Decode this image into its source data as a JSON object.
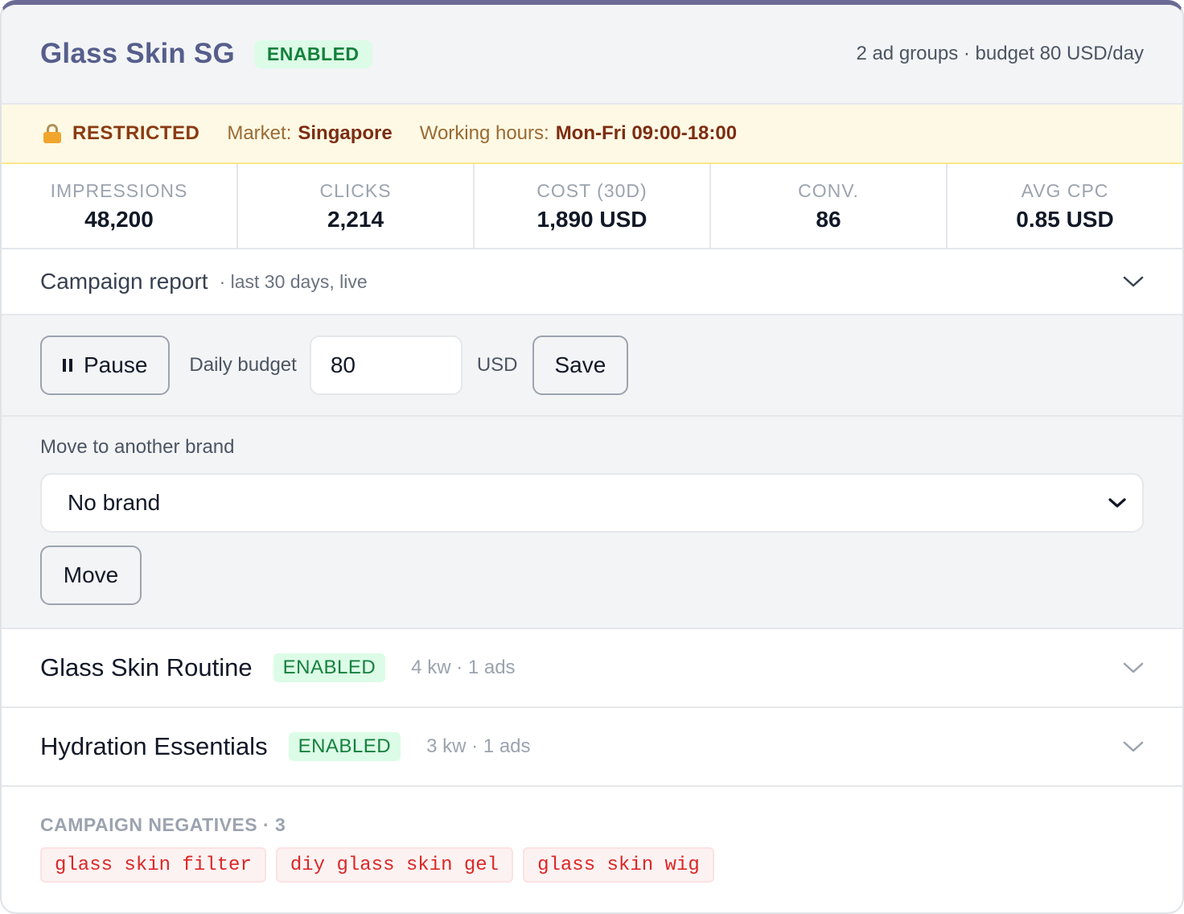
{
  "campaign": {
    "title": "Glass Skin SG",
    "status": "ENABLED",
    "meta": "2 ad groups · budget 80 USD/day"
  },
  "restriction": {
    "label": "RESTRICTED",
    "market_label": "Market:",
    "market_value": "Singapore",
    "hours_label": "Working hours:",
    "hours_value": "Mon-Fri 09:00-18:00"
  },
  "stats": [
    {
      "label": "IMPRESSIONS",
      "value": "48,200"
    },
    {
      "label": "CLICKS",
      "value": "2,214"
    },
    {
      "label": "COST (30D)",
      "value": "1,890 USD"
    },
    {
      "label": "CONV.",
      "value": "86"
    },
    {
      "label": "AVG CPC",
      "value": "0.85 USD"
    }
  ],
  "report": {
    "title": "Campaign report",
    "subtitle": "· last 30 days, live"
  },
  "controls": {
    "pause_label": "Pause",
    "budget_label": "Daily budget",
    "budget_value": "80",
    "currency": "USD",
    "save_label": "Save"
  },
  "move": {
    "label": "Move to another brand",
    "selected": "No brand",
    "button_label": "Move"
  },
  "ad_groups": [
    {
      "name": "Glass Skin Routine",
      "status": "ENABLED",
      "meta": "4 kw · 1 ads"
    },
    {
      "name": "Hydration Essentials",
      "status": "ENABLED",
      "meta": "3 kw · 1 ads"
    }
  ],
  "negatives": {
    "label": "CAMPAIGN NEGATIVES · 3",
    "items": [
      "glass skin filter",
      "diy glass skin gel",
      "glass skin wig"
    ]
  },
  "colors": {
    "accent_border": "#6a6b94",
    "title": "#565e8c",
    "enabled_bg": "#dcfce7",
    "enabled_text": "#15803d",
    "restricted_bg": "#fef9e4",
    "negative_text": "#dc2626"
  },
  "icons": {
    "lock": "lock-icon",
    "pause": "pause-icon",
    "chevron": "chevron-down-icon"
  }
}
